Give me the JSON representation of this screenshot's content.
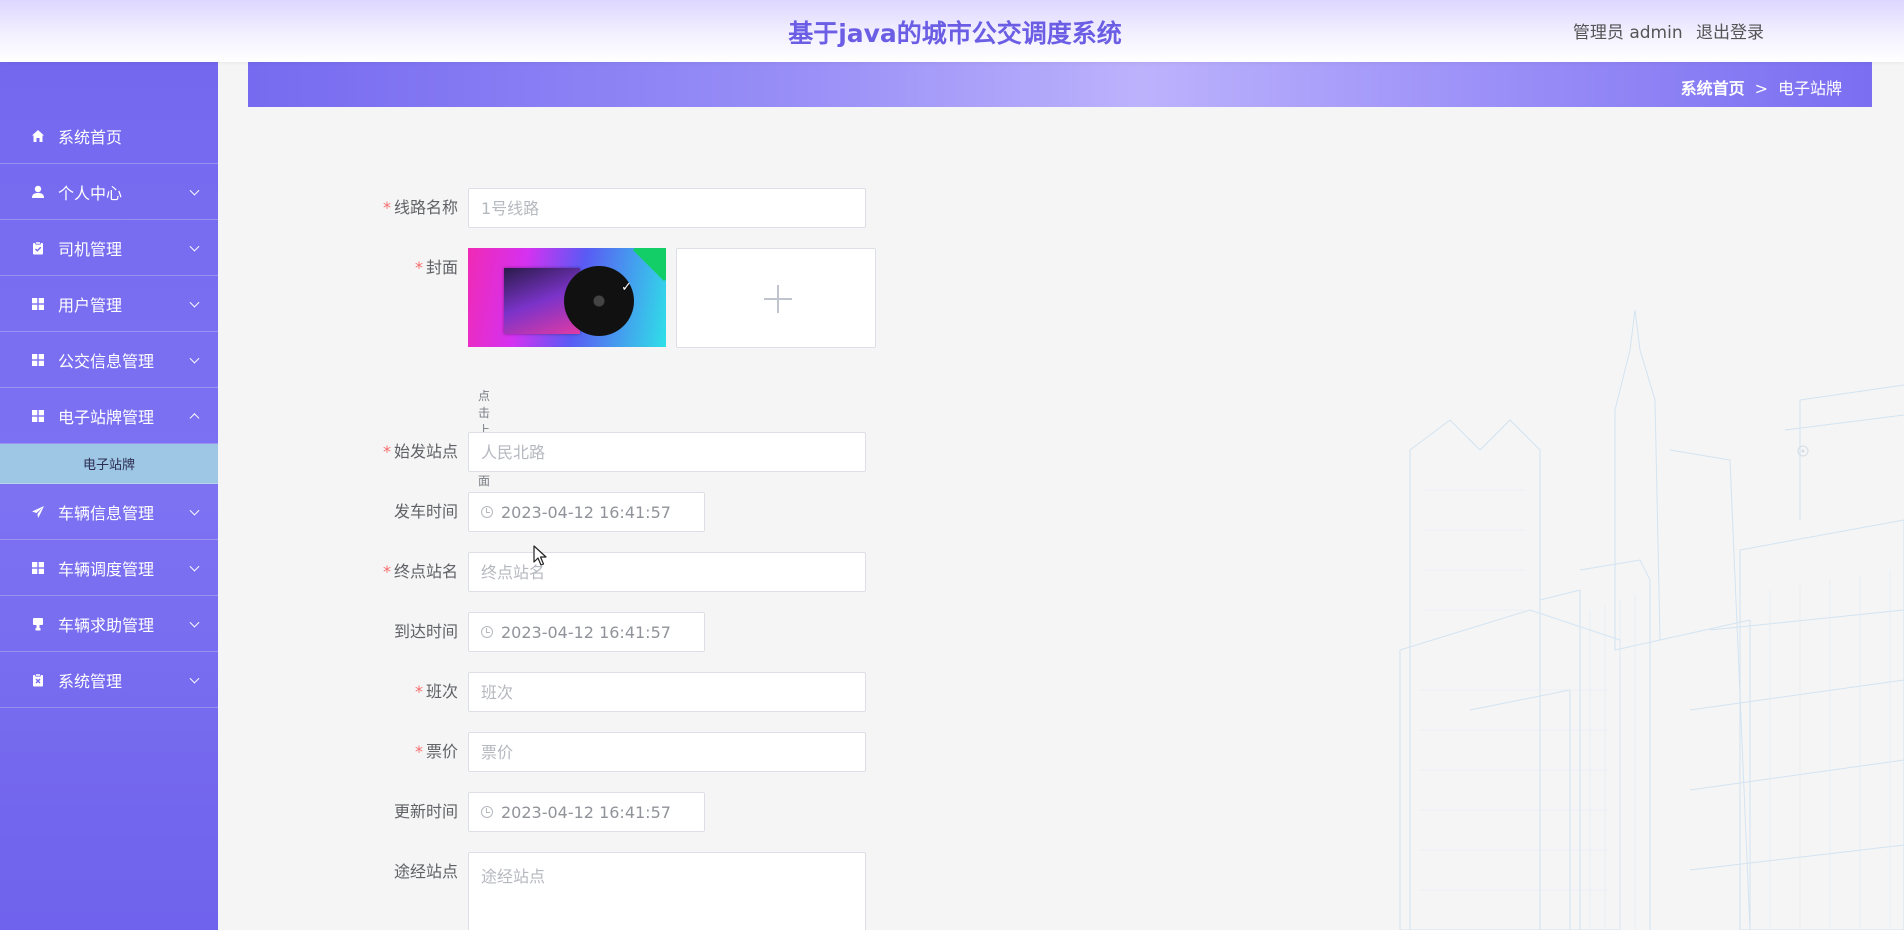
{
  "header": {
    "title": "基于java的城市公交调度系统",
    "user_label": "管理员 admin",
    "logout_label": "退出登录"
  },
  "sidebar": {
    "items": [
      {
        "label": "系统首页",
        "icon": "home-icon"
      },
      {
        "label": "个人中心",
        "icon": "person-icon"
      },
      {
        "label": "司机管理",
        "icon": "clipboard-icon"
      },
      {
        "label": "用户管理",
        "icon": "grid-icon"
      },
      {
        "label": "公交信息管理",
        "icon": "grid-icon"
      },
      {
        "label": "电子站牌管理",
        "icon": "grid-icon"
      },
      {
        "label": "车辆信息管理",
        "icon": "send-icon"
      },
      {
        "label": "车辆调度管理",
        "icon": "grid-icon"
      },
      {
        "label": "车辆求助管理",
        "icon": "stamp-icon"
      },
      {
        "label": "系统管理",
        "icon": "clipboard-x-icon"
      }
    ],
    "active_sub": "电子站牌"
  },
  "breadcrumb": {
    "home": "系统首页",
    "separator": ">",
    "current": "电子站牌"
  },
  "form": {
    "route_name": {
      "label": "线路名称",
      "value": "",
      "placeholder": "1号线路",
      "required": true
    },
    "cover": {
      "label": "封面",
      "hint": "点击上传封面",
      "required": true
    },
    "start_station": {
      "label": "始发站点",
      "value": "",
      "placeholder": "人民北路",
      "required": true
    },
    "depart_time": {
      "label": "发车时间",
      "value": "2023-04-12 16:41:57"
    },
    "end_station": {
      "label": "终点站名",
      "value": "",
      "placeholder": "终点站名",
      "required": true
    },
    "arrive_time": {
      "label": "到达时间",
      "value": "2023-04-12 16:41:57"
    },
    "shift": {
      "label": "班次",
      "value": "",
      "placeholder": "班次",
      "required": true
    },
    "fare": {
      "label": "票价",
      "value": "",
      "placeholder": "票价",
      "required": true
    },
    "update_time": {
      "label": "更新时间",
      "value": "2023-04-12 16:41:57"
    },
    "via_stations": {
      "label": "途经站点",
      "value": "",
      "placeholder": "途经站点"
    }
  },
  "colors": {
    "sidebar": "#7468ef",
    "title": "#6b5ee5",
    "submenu_active": "#9ec7e6",
    "required_star": "#f56c6c"
  }
}
